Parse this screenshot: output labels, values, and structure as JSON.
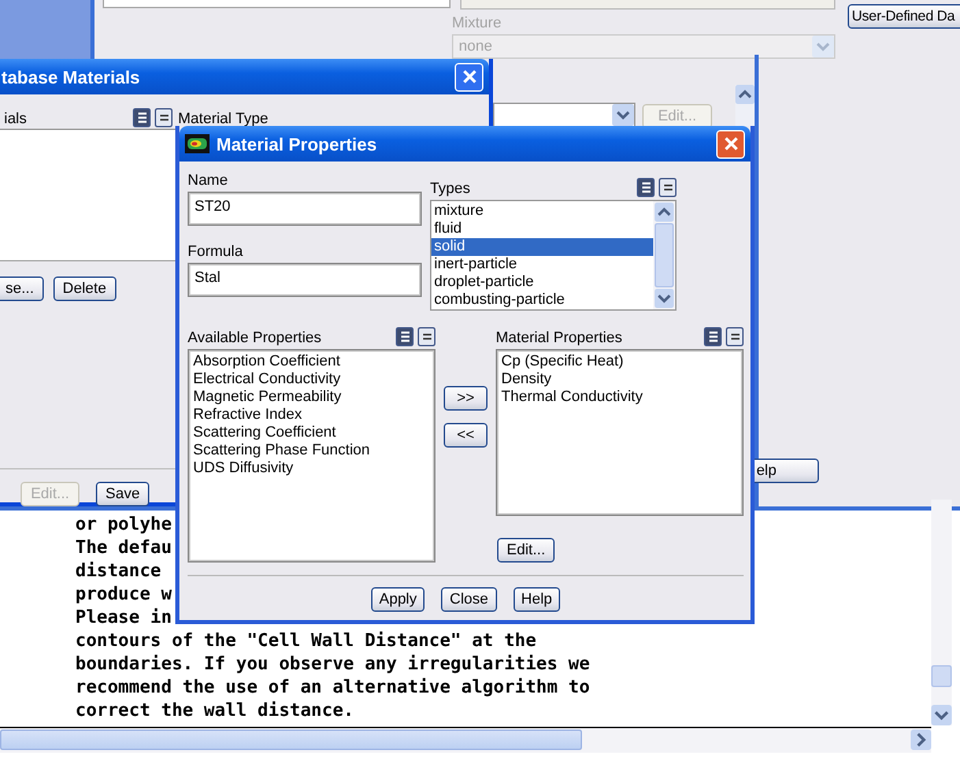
{
  "background": {
    "mixture_label": "Mixture",
    "mixture_value": "none",
    "mixture_disabled": true,
    "user_defined_button": "User-Defined Da",
    "edit_button": {
      "label": "Edit...",
      "disabled": true
    },
    "help_button": "elp"
  },
  "database_window": {
    "title": "tabase Materials",
    "list_label": "ials",
    "material_type_label": "Material Type",
    "buttons": [
      {
        "label": "se...",
        "disabled": false
      },
      {
        "label": "Delete",
        "disabled": false
      }
    ],
    "bottom_buttons": [
      {
        "label": "Edit...",
        "disabled": true
      },
      {
        "label": "Save",
        "disabled": false
      }
    ]
  },
  "dialog": {
    "title": "Material Properties",
    "name_label": "Name",
    "name_value": "ST20",
    "formula_label": "Formula",
    "formula_value": "Stal",
    "types_label": "Types",
    "types": [
      {
        "label": "mixture",
        "selected": false
      },
      {
        "label": "fluid",
        "selected": false
      },
      {
        "label": "solid",
        "selected": true
      },
      {
        "label": "inert-particle",
        "selected": false
      },
      {
        "label": "droplet-particle",
        "selected": false
      },
      {
        "label": "combusting-particle",
        "selected": false
      }
    ],
    "available_label": "Available Properties",
    "available": [
      "Absorption Coefficient",
      "Electrical Conductivity",
      "Magnetic Permeability",
      "Refractive Index",
      "Scattering Coefficient",
      "Scattering Phase Function",
      "UDS Diffusivity"
    ],
    "add_button": ">>",
    "remove_button": "<<",
    "material_label": "Material Properties",
    "material": [
      "Cp (Specific Heat)",
      "Density",
      "Thermal Conductivity"
    ],
    "edit_button": "Edit...",
    "buttons": [
      "Apply",
      "Close",
      "Help"
    ]
  },
  "console": {
    "lines": [
      "or polyhe",
      "The defau",
      "distance",
      "produce w",
      "Please in",
      "contours of the \"Cell Wall Distance\" at the",
      "boundaries. If you observe any irregularities we",
      "recommend the use of an alternative algorithm to",
      "correct the wall distance."
    ]
  }
}
